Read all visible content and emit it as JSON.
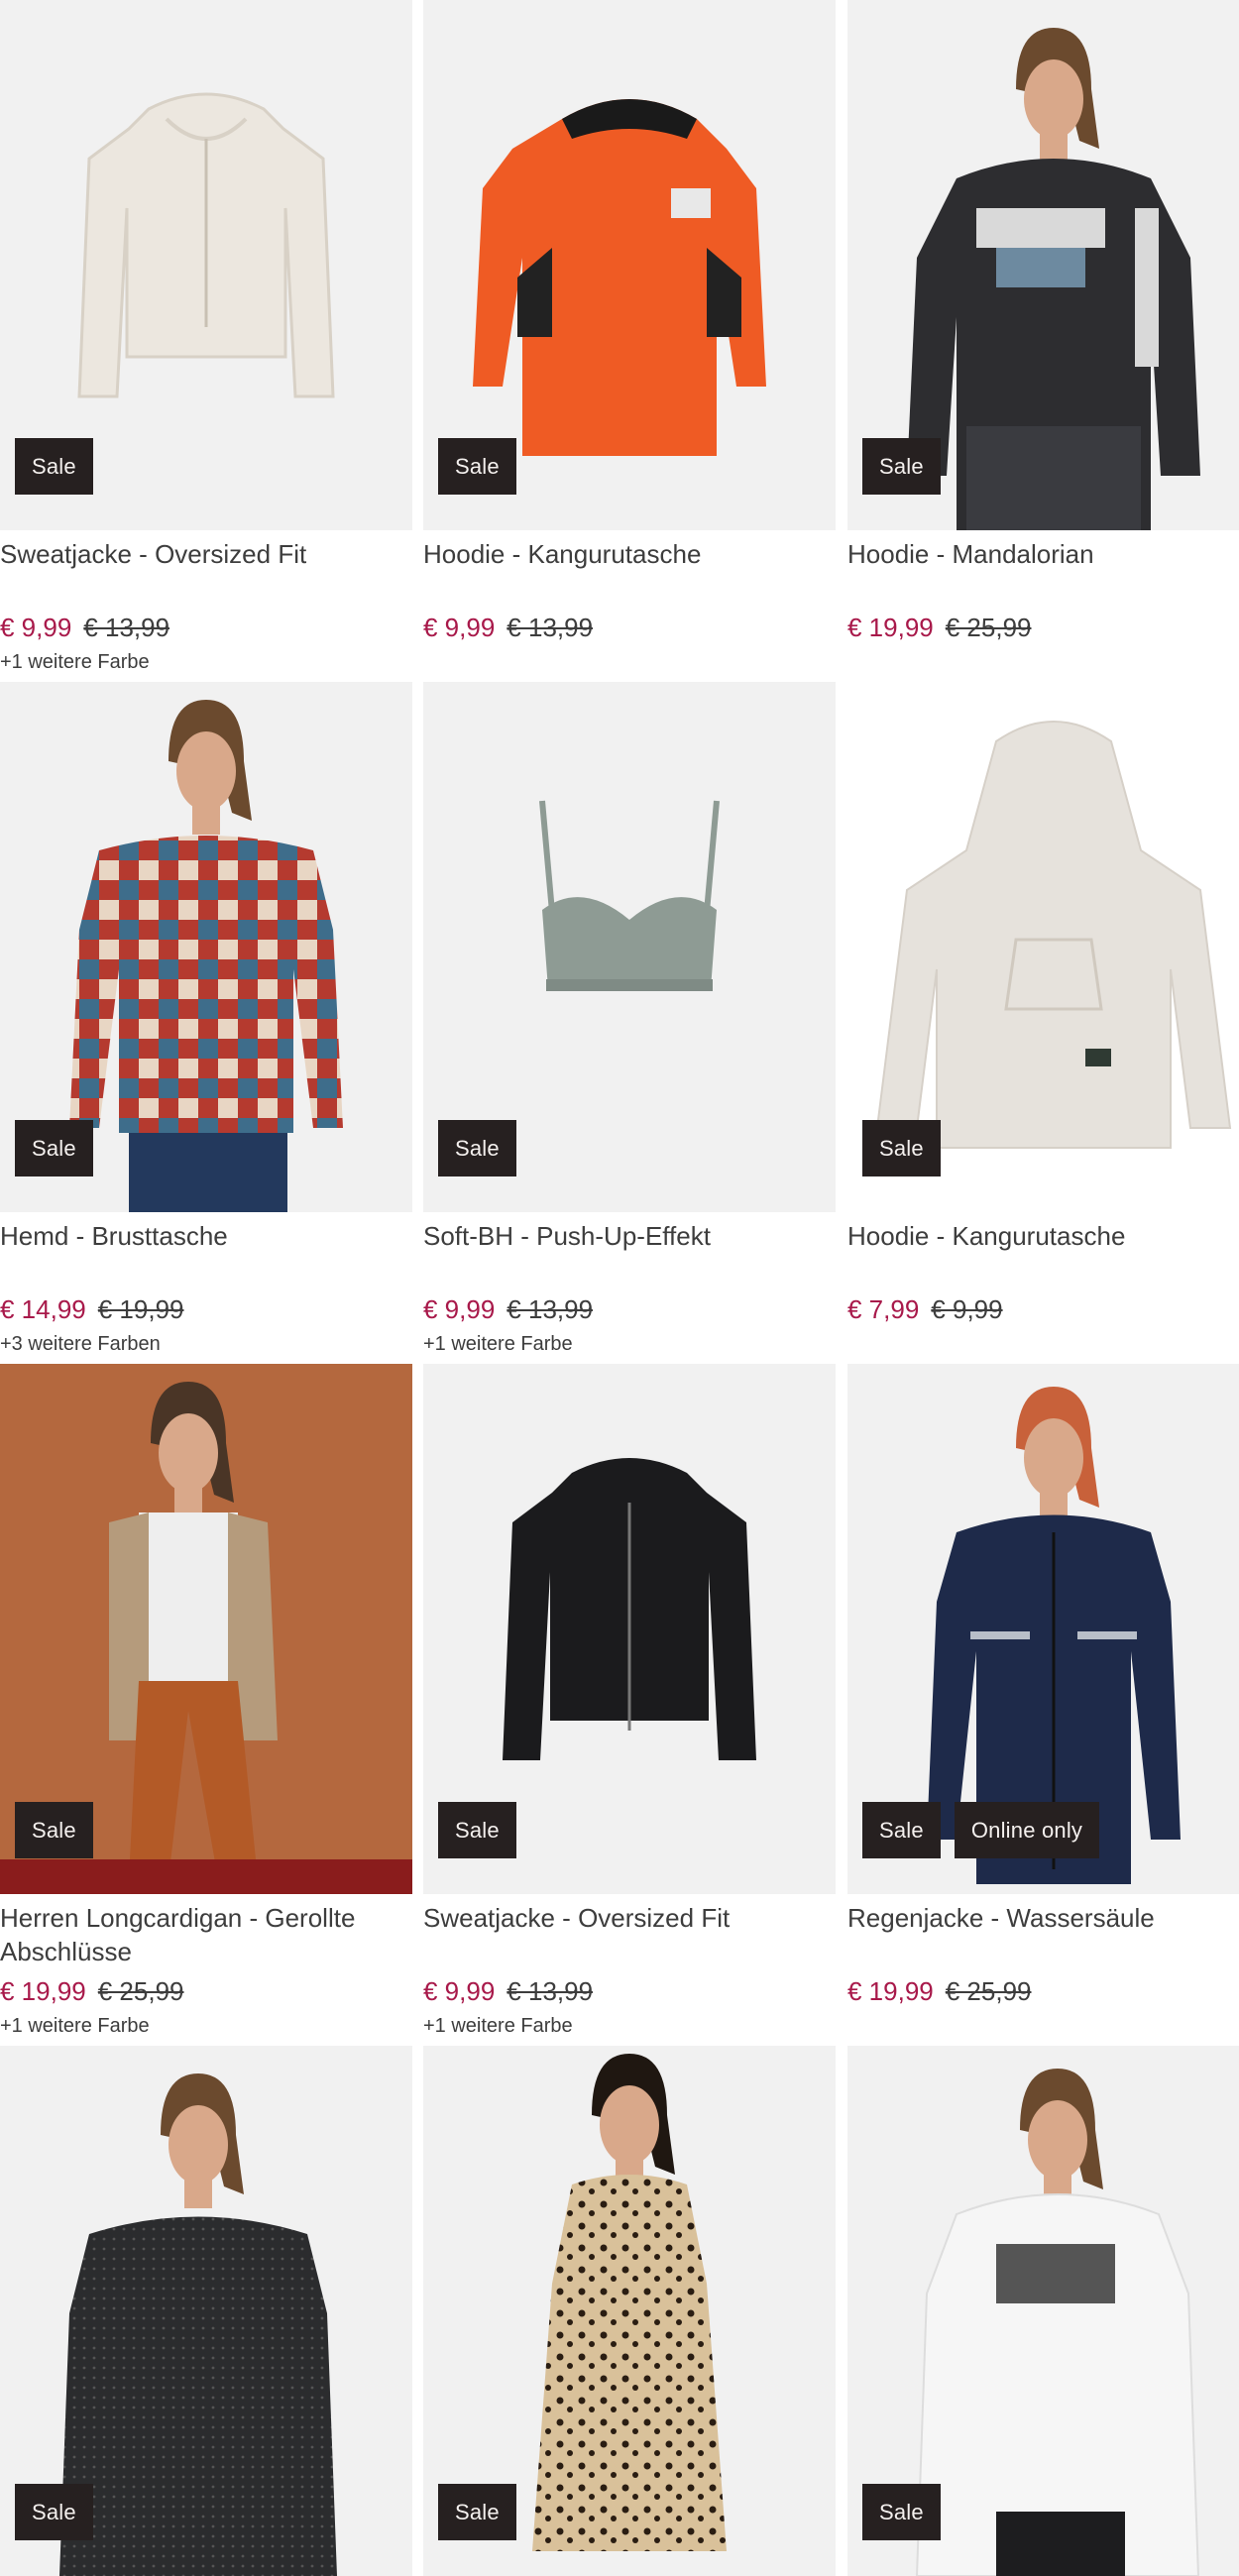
{
  "products": [
    {
      "title": "Sweatjacke - Oversized Fit",
      "price": "€ 9,99",
      "old_price": "€ 13,99",
      "colors": "+1 weitere Farbe",
      "badges": [
        "Sale"
      ],
      "image": "cream-zip-hoodie",
      "bg": "#f1f1f1"
    },
    {
      "title": "Hoodie - Kangurutasche",
      "price": "€ 9,99",
      "old_price": "€ 13,99",
      "colors": "",
      "badges": [
        "Sale"
      ],
      "image": "orange-hoodie",
      "bg": "#f1f1f1"
    },
    {
      "title": "Hoodie - Mandalorian",
      "price": "€ 19,99",
      "old_price": "€ 25,99",
      "colors": "",
      "badges": [
        "Sale"
      ],
      "image": "man-black-hoodie",
      "bg": "#f1f1f1"
    },
    {
      "title": "Hemd - Brusttasche",
      "price": "€ 14,99",
      "old_price": "€ 19,99",
      "colors": "+3 weitere Farben",
      "badges": [
        "Sale"
      ],
      "image": "man-check-shirt",
      "bg": "#f1f1f1"
    },
    {
      "title": "Soft-BH - Push-Up-Effekt",
      "price": "€ 9,99",
      "old_price": "€ 13,99",
      "colors": "+1 weitere Farbe",
      "badges": [
        "Sale"
      ],
      "image": "grey-bra",
      "bg": "#f1f1f1"
    },
    {
      "title": "Hoodie - Kangurutasche",
      "price": "€ 7,99",
      "old_price": "€ 9,99",
      "colors": "",
      "badges": [
        "Sale"
      ],
      "image": "grey-hoodie",
      "bg": "#ffffff"
    },
    {
      "title": "Herren Longcardigan - Gerollte Abschlüsse",
      "price": "€ 19,99",
      "old_price": "€ 25,99",
      "colors": "+1 weitere Farbe",
      "badges": [
        "Sale"
      ],
      "image": "man-cardigan",
      "bg": "#b4683e"
    },
    {
      "title": "Sweatjacke - Oversized Fit",
      "price": "€ 9,99",
      "old_price": "€ 13,99",
      "colors": "+1 weitere Farbe",
      "badges": [
        "Sale"
      ],
      "image": "black-zip-hoodie",
      "bg": "#f1f1f1"
    },
    {
      "title": "Regenjacke - Wassersäule",
      "price": "€ 19,99",
      "old_price": "€ 25,99",
      "colors": "",
      "badges": [
        "Sale",
        "Online only"
      ],
      "image": "woman-rain-jacket",
      "bg": "#f1f1f1"
    },
    {
      "title": "",
      "price": "",
      "old_price": "",
      "colors": "",
      "badges": [
        "Sale"
      ],
      "image": "man-dark-shirt",
      "bg": "#f1f1f1"
    },
    {
      "title": "",
      "price": "",
      "old_price": "",
      "colors": "",
      "badges": [
        "Sale"
      ],
      "image": "woman-leopard-dress",
      "bg": "#f1f1f1"
    },
    {
      "title": "",
      "price": "",
      "old_price": "",
      "colors": "",
      "badges": [
        "Sale"
      ],
      "image": "man-white-hoodie",
      "bg": "#f1f1f1"
    }
  ],
  "colors": {
    "accent_price": "#a8194a",
    "badge_bg": "#262020",
    "badge_text": "#f4f0ee"
  }
}
